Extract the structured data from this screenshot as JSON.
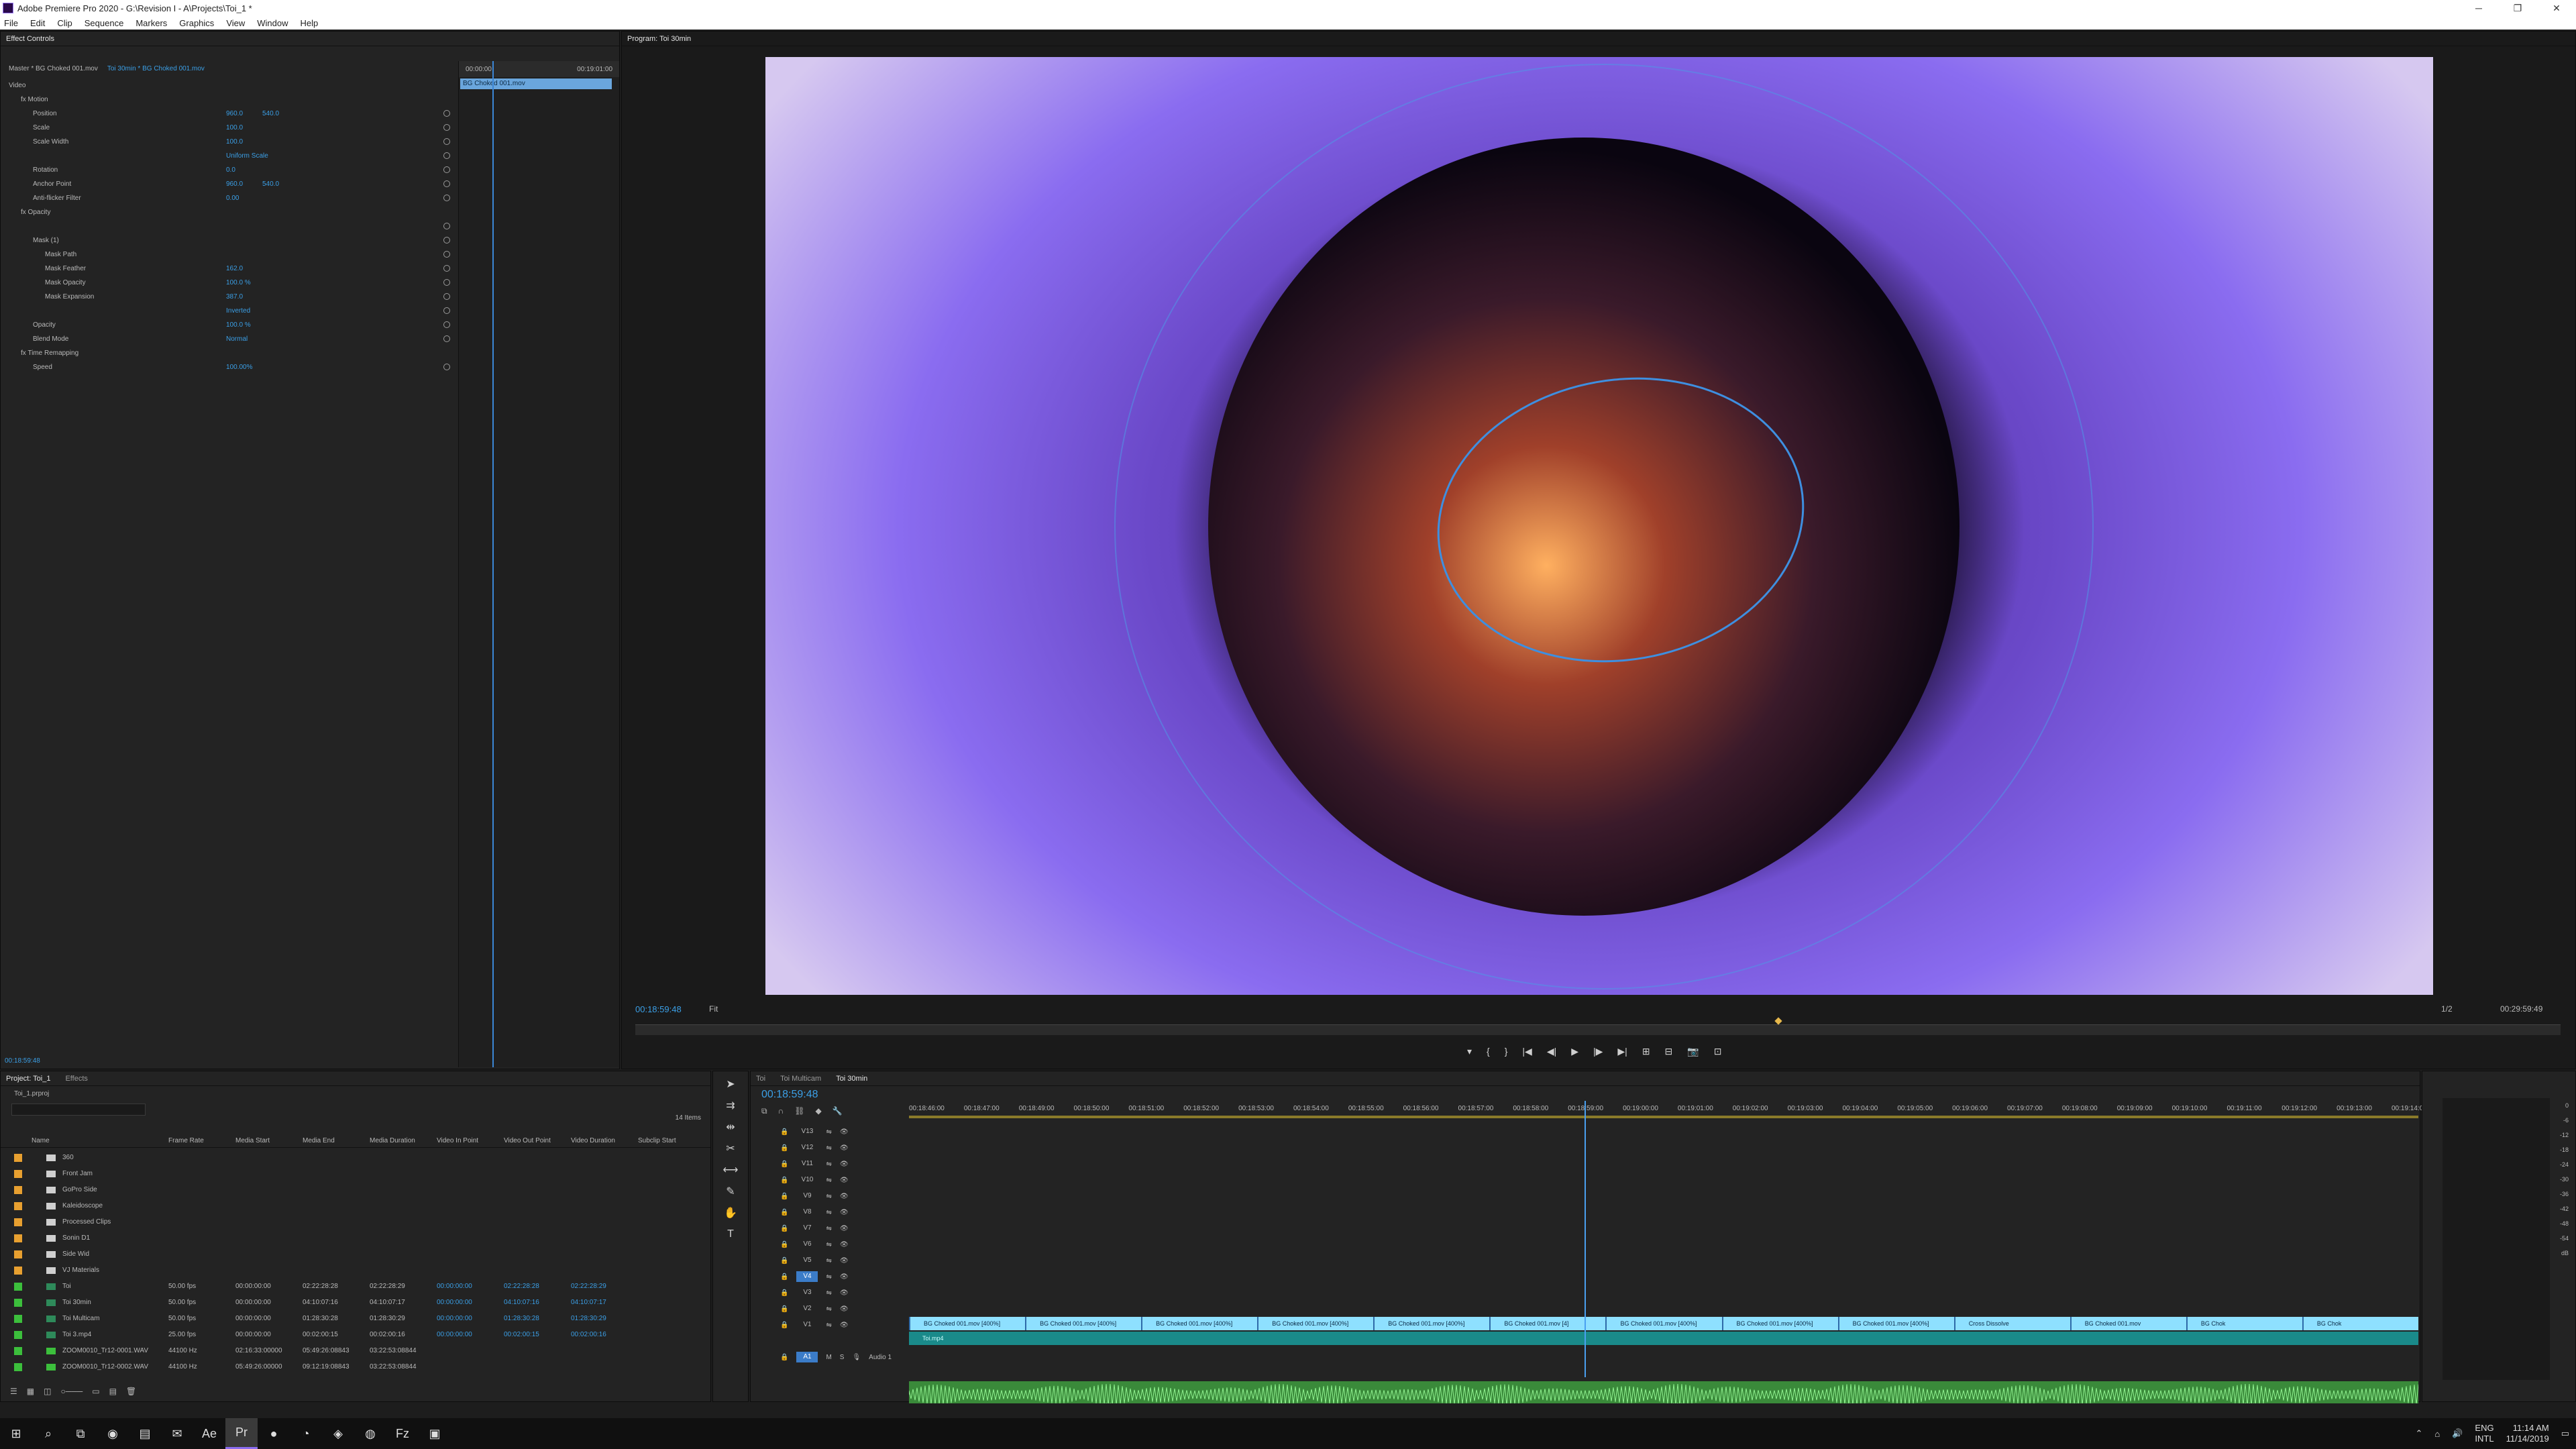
{
  "window": {
    "title": "Adobe Premiere Pro 2020 - G:\\Revision I - A\\Projects\\Toi_1 *"
  },
  "menu": [
    "File",
    "Edit",
    "Clip",
    "Sequence",
    "Markers",
    "Graphics",
    "View",
    "Window",
    "Help"
  ],
  "effect_controls": {
    "tab_label": "Effect Controls",
    "master_label": "Master * BG Choked 001.mov",
    "sequence_clip_label": "Toi 30min * BG Choked 001.mov",
    "mini_ruler_start": "00:00:00",
    "mini_ruler_end": "00:19:01:00",
    "mini_clip_label": "BG Choked 001.mov",
    "timecode": "00:18:59:48",
    "rows": [
      {
        "label": "Video",
        "value": "",
        "value2": "",
        "indent": 0
      },
      {
        "label": "fx  Motion",
        "value": "",
        "value2": "",
        "indent": 1
      },
      {
        "label": "Position",
        "value": "960.0",
        "value2": "540.0",
        "indent": 2
      },
      {
        "label": "Scale",
        "value": "100.0",
        "value2": "",
        "indent": 2
      },
      {
        "label": "Scale Width",
        "value": "100.0",
        "value2": "",
        "indent": 2
      },
      {
        "label": "",
        "value": "Uniform Scale",
        "value2": "",
        "indent": 2
      },
      {
        "label": "Rotation",
        "value": "0.0",
        "value2": "",
        "indent": 2
      },
      {
        "label": "Anchor Point",
        "value": "960.0",
        "value2": "540.0",
        "indent": 2
      },
      {
        "label": "Anti-flicker Filter",
        "value": "0.00",
        "value2": "",
        "indent": 2
      },
      {
        "label": "fx  Opacity",
        "value": "",
        "value2": "",
        "indent": 1
      },
      {
        "label": "",
        "value": "",
        "value2": "",
        "indent": 2
      },
      {
        "label": "Mask (1)",
        "value": "",
        "value2": "",
        "indent": 2
      },
      {
        "label": "Mask Path",
        "value": "",
        "value2": "",
        "indent": 3
      },
      {
        "label": "Mask Feather",
        "value": "162.0",
        "value2": "",
        "indent": 3
      },
      {
        "label": "Mask Opacity",
        "value": "100.0 %",
        "value2": "",
        "indent": 3
      },
      {
        "label": "Mask Expansion",
        "value": "387.0",
        "value2": "",
        "indent": 3
      },
      {
        "label": "",
        "value": "Inverted",
        "value2": "",
        "indent": 3
      },
      {
        "label": "Opacity",
        "value": "100.0 %",
        "value2": "",
        "indent": 2
      },
      {
        "label": "Blend Mode",
        "value": "Normal",
        "value2": "",
        "indent": 2
      },
      {
        "label": "fx  Time Remapping",
        "value": "",
        "value2": "",
        "indent": 1
      },
      {
        "label": "Speed",
        "value": "100.00%",
        "value2": "",
        "indent": 2
      }
    ]
  },
  "program_monitor": {
    "tab_label": "Program: Toi 30min",
    "timecode_left": "00:18:59:48",
    "fit_label": "Fit",
    "resolution": "1/2",
    "timecode_right": "00:29:59:49",
    "transport": [
      "▾",
      "{",
      "}",
      "|◀",
      "◀|",
      "▶",
      "|▶",
      "▶|",
      "⊞",
      "⊟",
      "📷",
      "⊡"
    ]
  },
  "project": {
    "tabs": [
      "Project: Toi_1",
      "Effects"
    ],
    "active_tab": 0,
    "breadcrumb": "Toi_1.prproj",
    "item_count": "14 Items",
    "columns": [
      "Name",
      "Frame Rate",
      "Media Start",
      "Media End",
      "Media Duration",
      "Video In Point",
      "Video Out Point",
      "Video Duration",
      "Subclip Start"
    ],
    "rows": [
      {
        "color": "#e8a030",
        "type": "folder",
        "name": "360",
        "fps": "",
        "start": "",
        "end": "",
        "dur": "",
        "vin": "",
        "vout": "",
        "vdur": ""
      },
      {
        "color": "#e8a030",
        "type": "folder",
        "name": "Front Jam",
        "fps": "",
        "start": "",
        "end": "",
        "dur": "",
        "vin": "",
        "vout": "",
        "vdur": ""
      },
      {
        "color": "#e8a030",
        "type": "folder",
        "name": "GoPro Side",
        "fps": "",
        "start": "",
        "end": "",
        "dur": "",
        "vin": "",
        "vout": "",
        "vdur": ""
      },
      {
        "color": "#e8a030",
        "type": "folder",
        "name": "Kaleidoscope",
        "fps": "",
        "start": "",
        "end": "",
        "dur": "",
        "vin": "",
        "vout": "",
        "vdur": ""
      },
      {
        "color": "#e8a030",
        "type": "folder",
        "name": "Processed Clips",
        "fps": "",
        "start": "",
        "end": "",
        "dur": "",
        "vin": "",
        "vout": "",
        "vdur": ""
      },
      {
        "color": "#e8a030",
        "type": "folder",
        "name": "Sonin D1",
        "fps": "",
        "start": "",
        "end": "",
        "dur": "",
        "vin": "",
        "vout": "",
        "vdur": ""
      },
      {
        "color": "#e8a030",
        "type": "folder",
        "name": "Side Wid",
        "fps": "",
        "start": "",
        "end": "",
        "dur": "",
        "vin": "",
        "vout": "",
        "vdur": ""
      },
      {
        "color": "#e8a030",
        "type": "folder",
        "name": "VJ Materials",
        "fps": "",
        "start": "",
        "end": "",
        "dur": "",
        "vin": "",
        "vout": "",
        "vdur": ""
      },
      {
        "color": "#3cbf3c",
        "type": "seq",
        "name": "Toi",
        "fps": "50.00 fps",
        "start": "00:00:00:00",
        "end": "02:22:28:28",
        "dur": "02:22:28:29",
        "vin": "00:00:00:00",
        "vout": "02:22:28:28",
        "vdur": "02:22:28:29"
      },
      {
        "color": "#3cbf3c",
        "type": "seq",
        "name": "Toi 30min",
        "fps": "50.00 fps",
        "start": "00:00:00:00",
        "end": "04:10:07:16",
        "dur": "04:10:07:17",
        "vin": "00:00:00:00",
        "vout": "04:10:07:16",
        "vdur": "04:10:07:17"
      },
      {
        "color": "#3cbf3c",
        "type": "seq",
        "name": "Toi Multicam",
        "fps": "50.00 fps",
        "start": "00:00:00:00",
        "end": "01:28:30:28",
        "dur": "01:28:30:29",
        "vin": "00:00:00:00",
        "vout": "01:28:30:28",
        "vdur": "01:28:30:29"
      },
      {
        "color": "#3cbf3c",
        "type": "seq",
        "name": "Toi 3.mp4",
        "fps": "25.00 fps",
        "start": "00:00:00:00",
        "end": "00:02:00:15",
        "dur": "00:02:00:16",
        "vin": "00:00:00:00",
        "vout": "00:02:00:15",
        "vdur": "00:02:00:16"
      },
      {
        "color": "#3cbf3c",
        "type": "audio",
        "name": "ZOOM0010_Tr12-0001.WAV",
        "fps": "44100 Hz",
        "start": "02:16:33:00000",
        "end": "05:49:26:08843",
        "dur": "03:22:53:08844",
        "vin": "",
        "vout": "",
        "vdur": ""
      },
      {
        "color": "#3cbf3c",
        "type": "audio",
        "name": "ZOOM0010_Tr12-0002.WAV",
        "fps": "44100 Hz",
        "start": "05:49:26:00000",
        "end": "09:12:19:08843",
        "dur": "03:22:53:08844",
        "vin": "",
        "vout": "",
        "vdur": ""
      }
    ]
  },
  "timeline": {
    "tabs": [
      "Toi",
      "Toi Multicam",
      "Toi 30min"
    ],
    "active_tab": 2,
    "timecode": "00:18:59:48",
    "ruler_ticks": [
      "00:18:46:00",
      "00:18:47:00",
      "00:18:49:00",
      "00:18:50:00",
      "00:18:51:00",
      "00:18:52:00",
      "00:18:53:00",
      "00:18:54:00",
      "00:18:55:00",
      "00:18:56:00",
      "00:18:57:00",
      "00:18:58:00",
      "00:18:59:00",
      "00:19:00:00",
      "00:19:01:00",
      "00:19:02:00",
      "00:19:03:00",
      "00:19:04:00",
      "00:19:05:00",
      "00:19:06:00",
      "00:19:07:00",
      "00:19:08:00",
      "00:19:09:00",
      "00:19:10:00",
      "00:19:11:00",
      "00:19:12:00",
      "00:19:13:00",
      "00:19:14:0"
    ],
    "video_tracks": [
      "V13",
      "V12",
      "V11",
      "V10",
      "V9",
      "V8",
      "V7",
      "V6",
      "V5",
      "V4",
      "V3",
      "V2",
      "V1"
    ],
    "active_video_track": "V4",
    "audio_tracks": [
      "A1",
      "A2"
    ],
    "audio_track_label": "Audio 1",
    "clips_v4": [
      "BG Choked 001.mov [400%]",
      "BG Choked 001.mov [400%]",
      "BG Choked 001.mov [400%]",
      "BG Choked 001.mov [400%]",
      "BG Choked 001.mov [400%]",
      "BG Choked 001.mov [4]",
      "BG Choked 001.mov [400%]",
      "BG Choked 001.mov [400%]",
      "BG Choked 001.mov [400%]",
      "Cross Dissolve",
      "BG Choked 001.mov",
      "BG Chok",
      "BG Chok"
    ],
    "clip_v3": "Toi.mp4"
  },
  "meter": {
    "scale": [
      "0",
      "-6",
      "-12",
      "-18",
      "-24",
      "-30",
      "-36",
      "-42",
      "-48",
      "-54",
      "dB"
    ]
  },
  "taskbar": {
    "icons": [
      "windows-start",
      "search",
      "task-view",
      "chrome",
      "file-explorer",
      "mail",
      "premiere-a",
      "premiere-b",
      "spotify-like",
      "whatsapp",
      "app-9",
      "app-10",
      "filezilla",
      "app-12"
    ],
    "active_index": 7,
    "lang": "ENG",
    "region": "INTL",
    "time": "11:14 AM",
    "date": "11/14/2019"
  }
}
